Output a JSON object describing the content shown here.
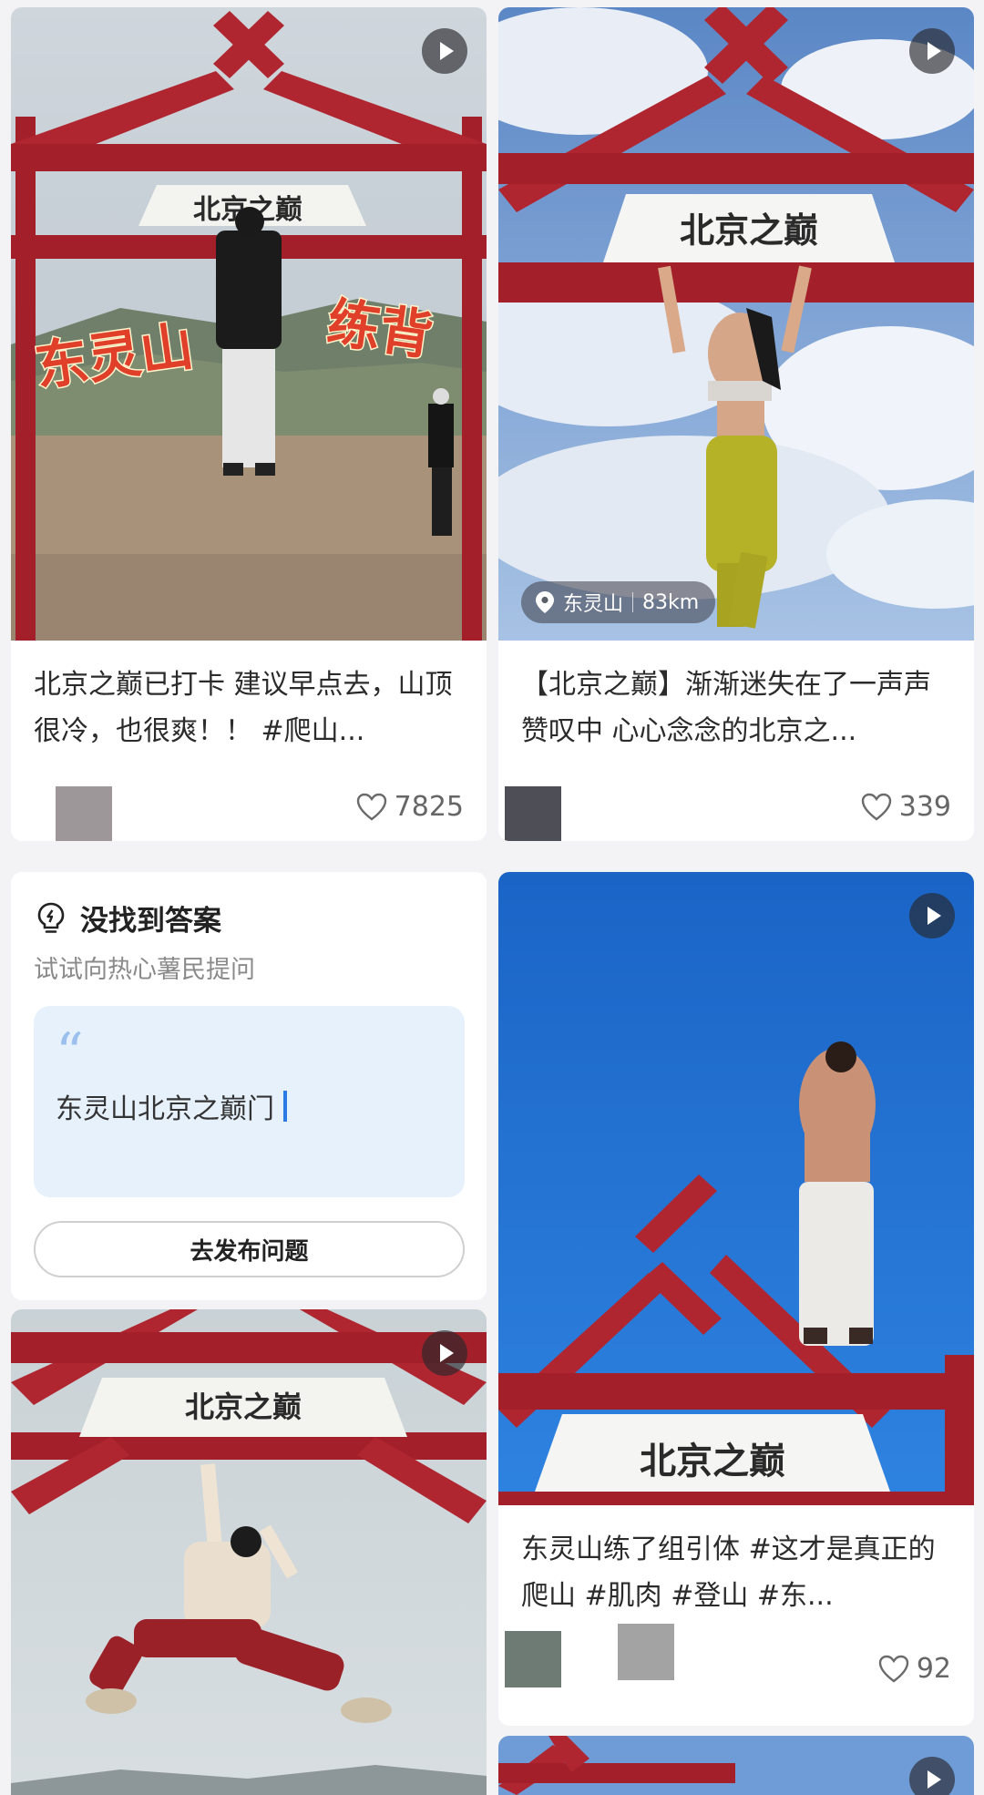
{
  "feed": {
    "cards": [
      {
        "title": "北京之巅已打卡 建议早点去，山顶很冷，也很爽！！ #爬山...",
        "likes": "7825",
        "sign_text": "北京之巅",
        "overlay_left": "东灵山",
        "overlay_right": "练背",
        "has_video": true
      },
      {
        "title": "【北京之巅】渐渐迷失在了一声声赞叹中 心心念念的北京之...",
        "likes": "339",
        "sign_text": "北京之巅",
        "location": {
          "name": "东灵山",
          "distance": "83km"
        },
        "has_video": true
      },
      {
        "title": "东灵山练了组引体 #这才是真正的爬山 #肌肉 #登山 #东...",
        "likes": "92",
        "sign_text": "北京之巅",
        "has_video": true
      },
      {
        "sign_text": "北京之巅",
        "has_video": true
      }
    ],
    "ask_card": {
      "title": "没找到答案",
      "subtitle": "试试向热心薯民提问",
      "quote_mark": "“",
      "query": "东灵山北京之巅门",
      "button": "去发布问题"
    }
  },
  "colors": {
    "frame_red": "#a3202a",
    "sky_blue": "#1f6fd0",
    "caret_blue": "#2a7be4",
    "quote_box": "#e6f1fc"
  },
  "icons": [
    "play-icon",
    "location-pin-icon",
    "heart-icon",
    "lightbulb-icon"
  ]
}
